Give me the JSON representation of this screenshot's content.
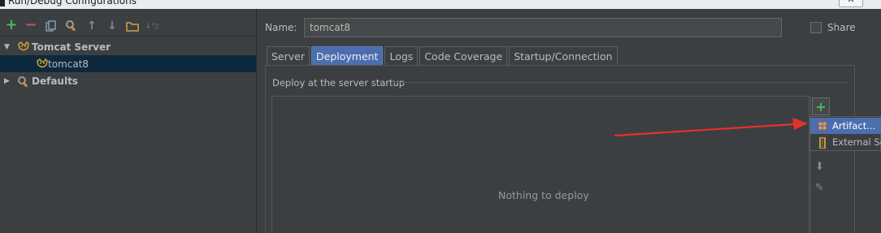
{
  "window": {
    "title": "Run/Debug Configurations",
    "close_glyph": "✕"
  },
  "toolbar": {
    "icons": [
      "add-icon",
      "remove-icon",
      "copy-icon",
      "settings-icon",
      "move-up-icon",
      "move-down-icon",
      "folder-icon",
      "sort-icon"
    ],
    "add_glyph": "+",
    "remove_glyph": "−",
    "up_glyph": "↑",
    "down_glyph": "↓",
    "sort_glyph": "↓ᵃz"
  },
  "tree": {
    "items": [
      {
        "label": "Tomcat Server",
        "expanded": true
      },
      {
        "label": "tomcat8",
        "selected": true
      },
      {
        "label": "Defaults",
        "expanded": false
      }
    ],
    "expanded_glyph": "▼",
    "collapsed_glyph": "▶"
  },
  "form": {
    "name_label": "Name:",
    "name_value": "tomcat8",
    "share_label": "Share",
    "share_checked": false
  },
  "tabs": [
    {
      "label": "Server",
      "active": false
    },
    {
      "label": "Deployment",
      "active": true
    },
    {
      "label": "Logs",
      "active": false
    },
    {
      "label": "Code Coverage",
      "active": false
    },
    {
      "label": "Startup/Connection",
      "active": false
    }
  ],
  "deployment": {
    "section_title": "Deploy at the server startup",
    "empty_text": "Nothing to deploy",
    "add_glyph": "+",
    "down_glyph": "⬇",
    "edit_glyph": "✎"
  },
  "popup": {
    "items": [
      {
        "label": "Artifact...",
        "highlighted": true,
        "icon": "artifact-icon"
      },
      {
        "label": "External Source...",
        "highlighted": false,
        "icon": "external-source-icon"
      }
    ]
  },
  "colors": {
    "accent": "#4b6eaf",
    "add_green": "#4cbb50",
    "remove_red": "#c75450",
    "annotation_red": "#e8302b"
  }
}
